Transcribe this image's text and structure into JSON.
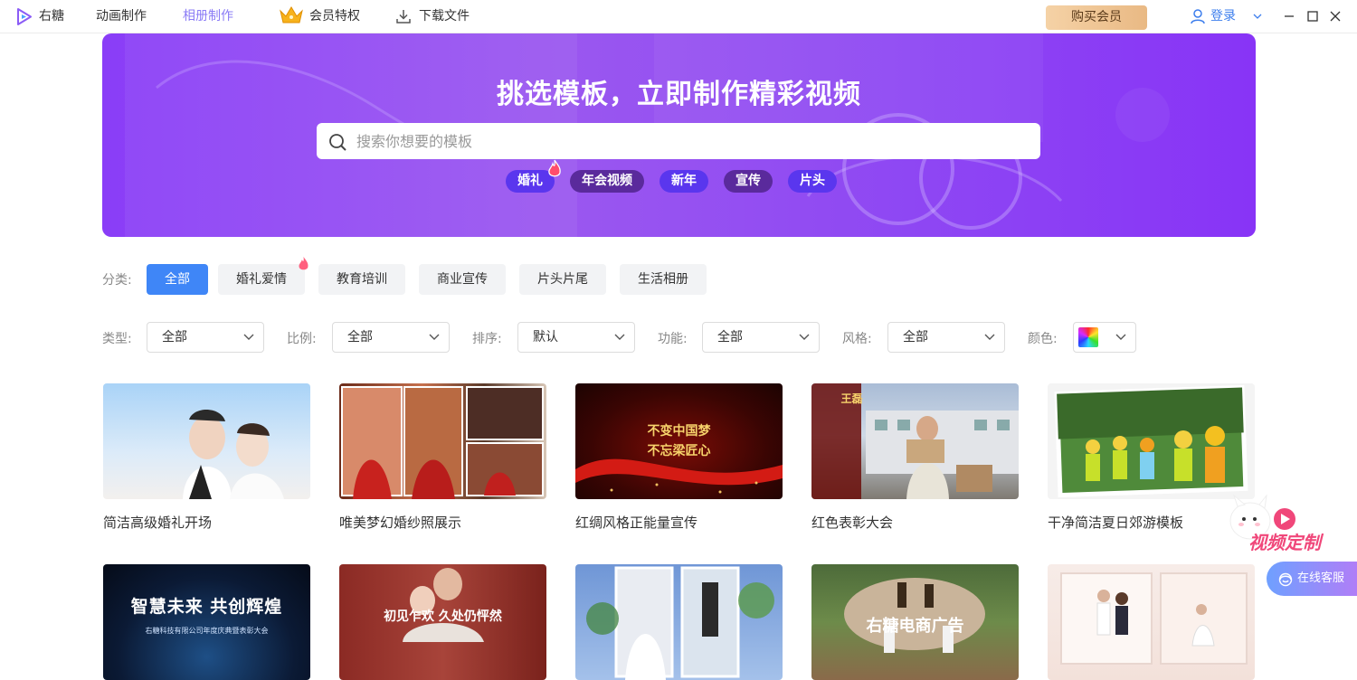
{
  "app": {
    "name": "右糖"
  },
  "topnav": {
    "items": [
      "动画制作",
      "相册制作",
      "会员特权",
      "下载文件"
    ],
    "buy_label": "购买会员",
    "login_label": "登录"
  },
  "banner": {
    "title": "挑选模板，立即制作精彩视频",
    "search_placeholder": "搜索你想要的模板",
    "hot_tags": [
      "婚礼",
      "年会视频",
      "新年",
      "宣传",
      "片头"
    ]
  },
  "category": {
    "label": "分类:",
    "items": [
      "全部",
      "婚礼爱情",
      "教育培训",
      "商业宣传",
      "片头片尾",
      "生活相册"
    ],
    "selected": "全部"
  },
  "filters": [
    {
      "label": "类型:",
      "value": "全部"
    },
    {
      "label": "比例:",
      "value": "全部"
    },
    {
      "label": "排序:",
      "value": "默认"
    },
    {
      "label": "功能:",
      "value": "全部"
    },
    {
      "label": "风格:",
      "value": "全部"
    }
  ],
  "color_filter": {
    "label": "颜色:"
  },
  "templates": [
    {
      "title": "简洁高级婚礼开场"
    },
    {
      "title": "唯美梦幻婚纱照展示"
    },
    {
      "title": "红绸风格正能量宣传",
      "thumb_text": [
        "不变中国梦",
        "不忘梁匠心"
      ]
    },
    {
      "title": "红色表彰大会",
      "thumb_text": "王磊"
    },
    {
      "title": "干净简洁夏日郊游模板"
    }
  ],
  "templates_row2": [
    {
      "thumb_text": "智慧未来  共创辉煌",
      "thumb_sub": "右糖科技有限公司年度庆典暨表彰大会"
    },
    {
      "thumb_text": "初见乍欢 久处仍怦然"
    },
    {},
    {
      "thumb_text": "右糖电商广告"
    },
    {}
  ],
  "floating": {
    "video_custom": "视频定制",
    "online_service": "在线客服"
  },
  "colors": {
    "primary": "#3f86f7",
    "banner": "#8a3df7",
    "accent": "#8b7cf6"
  }
}
